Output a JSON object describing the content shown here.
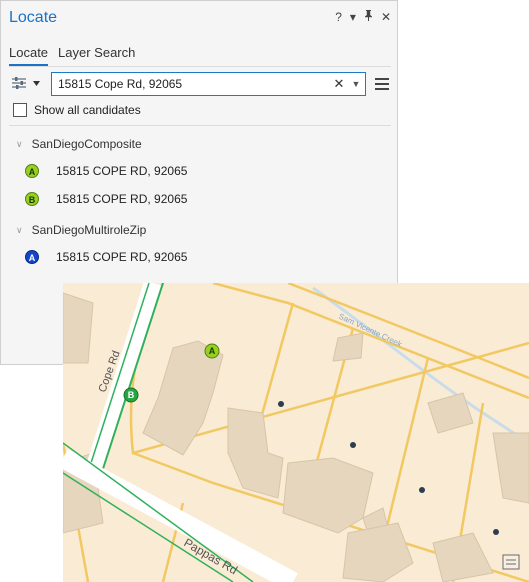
{
  "panel": {
    "title": "Locate",
    "controls": {
      "help": "?",
      "menu": "▾",
      "pin": "📌",
      "close": "✕"
    },
    "tabs": [
      {
        "label": "Locate",
        "active": true
      },
      {
        "label": "Layer Search",
        "active": false
      }
    ]
  },
  "search": {
    "value": "15815 Cope Rd, 92065",
    "clear_icon": "✕",
    "dropdown_icon": "▼"
  },
  "show_all": {
    "label": "Show all candidates",
    "checked": false
  },
  "groups": [
    {
      "name": "SanDiegoComposite",
      "results": [
        {
          "badge": "A",
          "address": "15815 COPE RD, 92065",
          "color": "#96d020"
        },
        {
          "badge": "B",
          "address": "15815 COPE RD, 92065",
          "color": "#96d020"
        }
      ]
    },
    {
      "name": "SanDiegoMultiroleZip",
      "results": [
        {
          "badge": "A",
          "address": "15815 COPE RD, 92065",
          "color": "#1444c8"
        }
      ]
    }
  ],
  "map": {
    "roads": [
      {
        "label": "Cope Rd"
      },
      {
        "label": "Pappas Rd"
      },
      {
        "label": "Sam Vicente Creek"
      }
    ],
    "markers": [
      {
        "label": "A",
        "color": "#96d020"
      },
      {
        "label": "B",
        "color": "#26a640"
      }
    ],
    "colors": {
      "background": "#faebd5",
      "building": "#e5d6bd",
      "parcel_line": "#f2c862",
      "road": "#ffffff",
      "creek": "#c8dcea",
      "green_line": "#2fb15c"
    }
  }
}
